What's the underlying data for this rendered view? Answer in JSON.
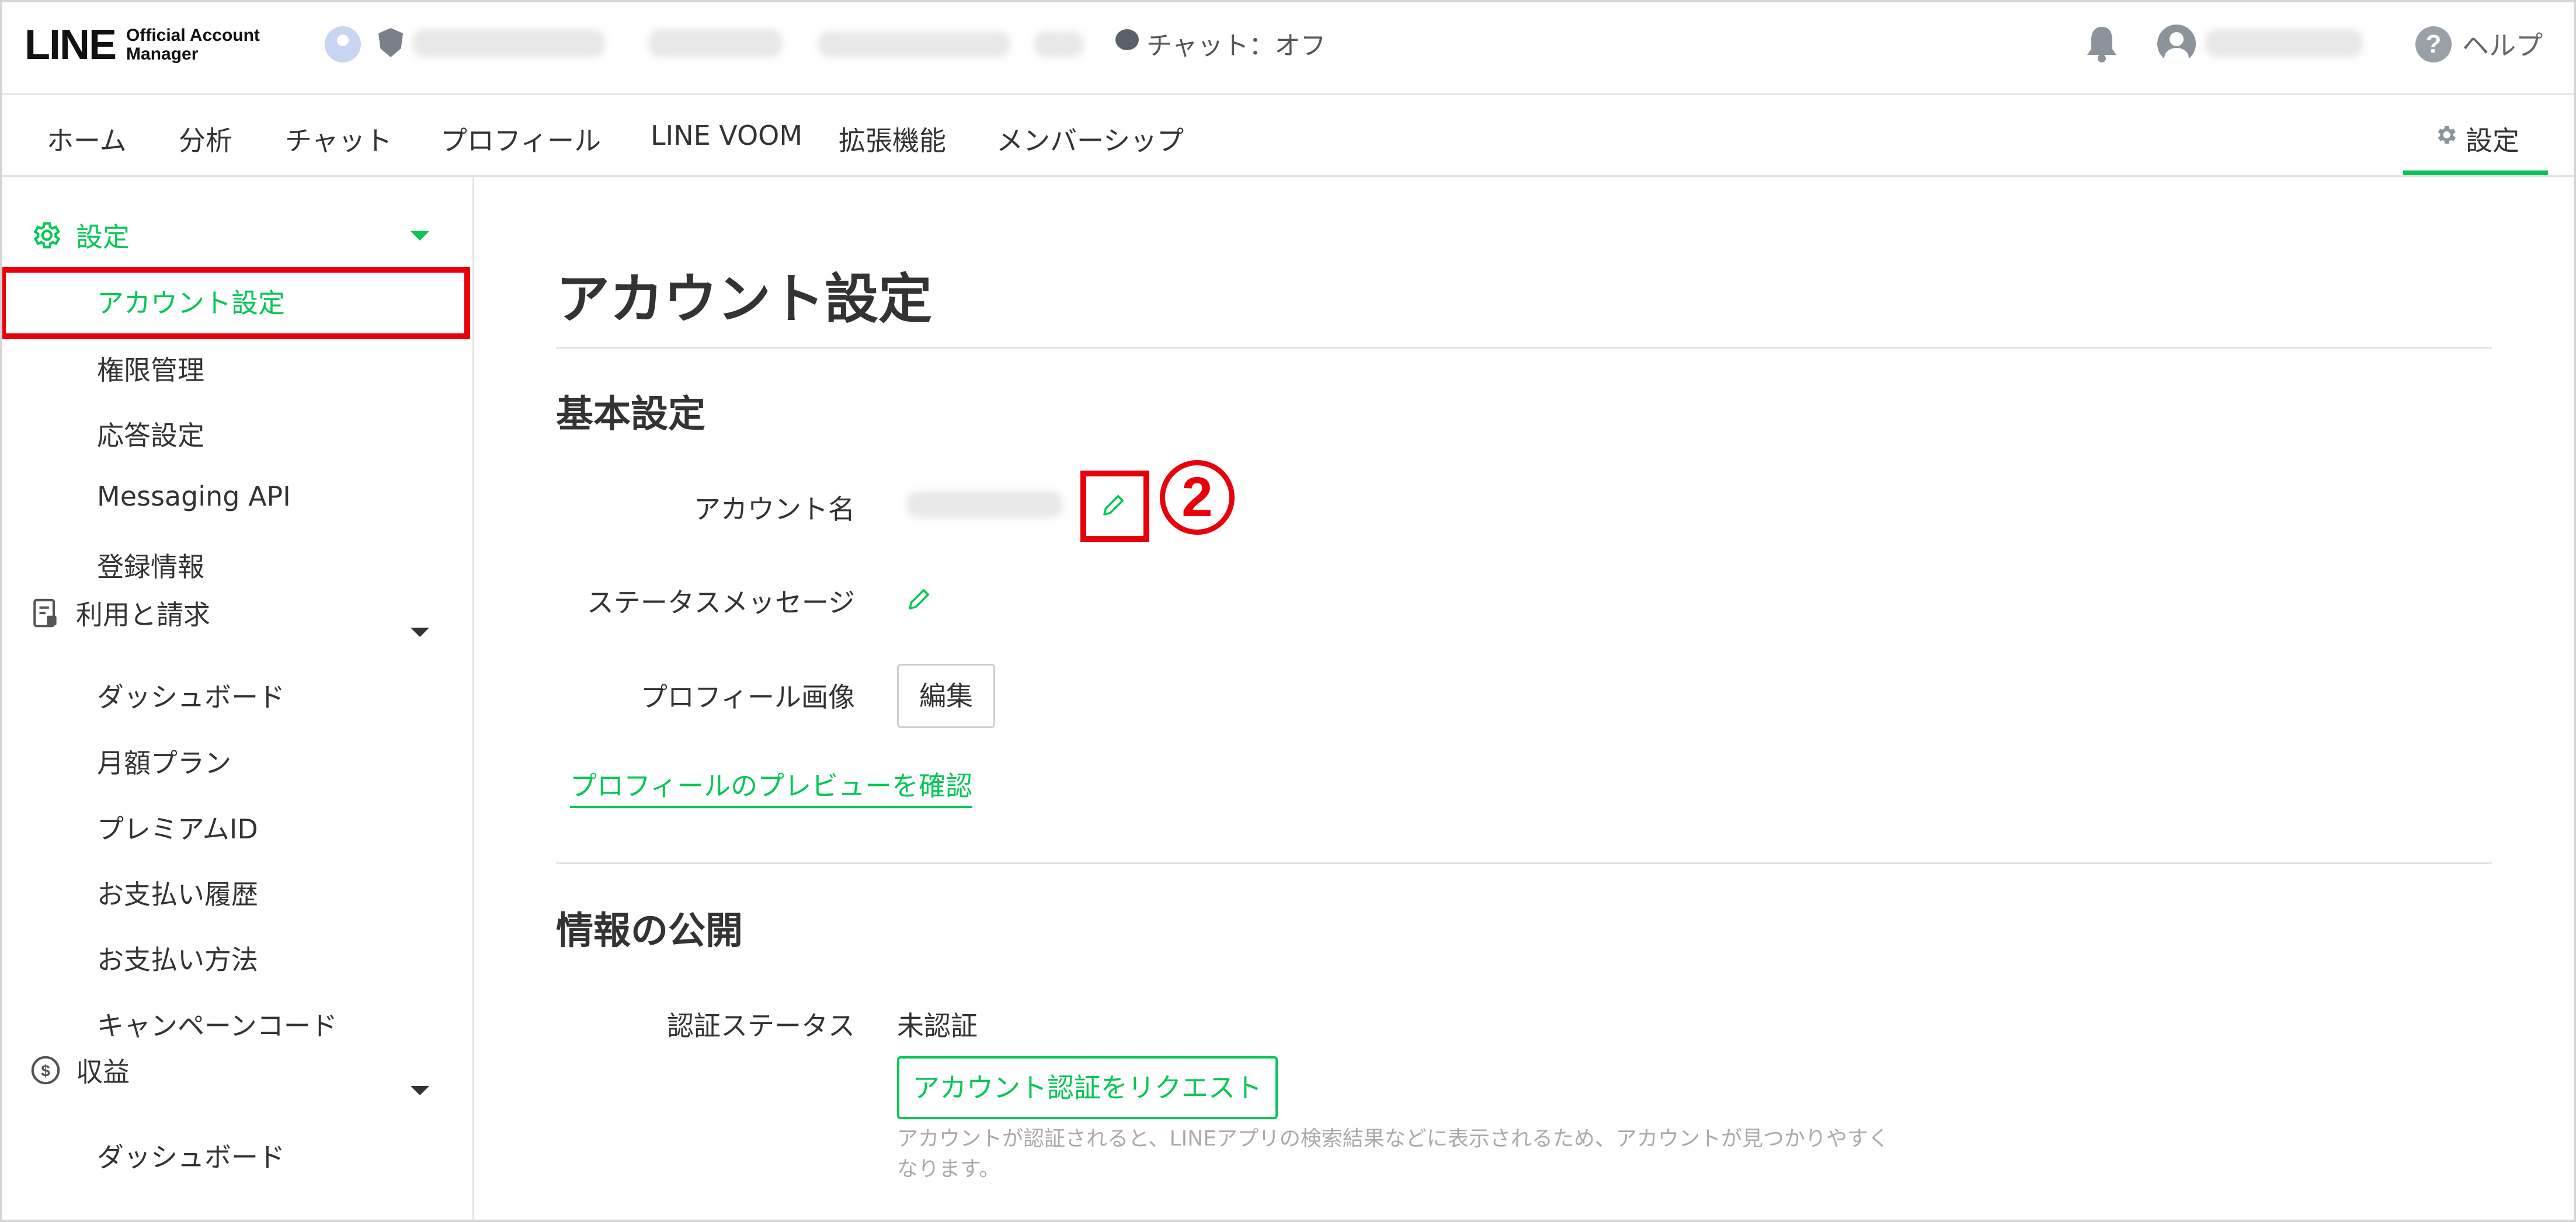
{
  "header": {
    "logo_main": "LINE",
    "logo_sub_line1": "Official Account",
    "logo_sub_line2": "Manager",
    "chat_status": "チャット：オフ",
    "help_label": "ヘルプ"
  },
  "nav": {
    "items": [
      "ホーム",
      "分析",
      "チャット",
      "プロフィール",
      "LINE VOOM",
      "拡張機能",
      "メンバーシップ"
    ],
    "settings_label": "設定"
  },
  "sidebar": {
    "sections": [
      {
        "label": "設定",
        "icon": "gear-icon",
        "items": [
          "アカウント設定",
          "権限管理",
          "応答設定",
          "Messaging API",
          "登録情報"
        ]
      },
      {
        "label": "利用と請求",
        "icon": "invoice-icon",
        "items": [
          "ダッシュボード",
          "月額プラン",
          "プレミアムID",
          "お支払い履歴",
          "お支払い方法",
          "キャンペーンコード"
        ]
      },
      {
        "label": "収益",
        "icon": "dollar-circle-icon",
        "items": [
          "ダッシュボード"
        ]
      }
    ]
  },
  "main": {
    "title": "アカウント設定",
    "basic": {
      "title": "基本設定",
      "account_name_label": "アカウント名",
      "status_message_label": "ステータスメッセージ",
      "profile_image_label": "プロフィール画像",
      "edit_button": "編集",
      "preview_link": "プロフィールのプレビューを確認"
    },
    "annotation_marker": "2",
    "info": {
      "title": "情報の公開",
      "cert_status_label": "認証ステータス",
      "cert_status_value": "未認証",
      "request_button": "アカウント認証をリクエスト",
      "note_line1": "アカウントが認証されると、LINEアプリの検索結果などに表示されるため、アカウントが見つかりやすく",
      "note_line2": "なります。"
    }
  },
  "colors": {
    "accent": "#06c755",
    "highlight": "#e8000b"
  }
}
